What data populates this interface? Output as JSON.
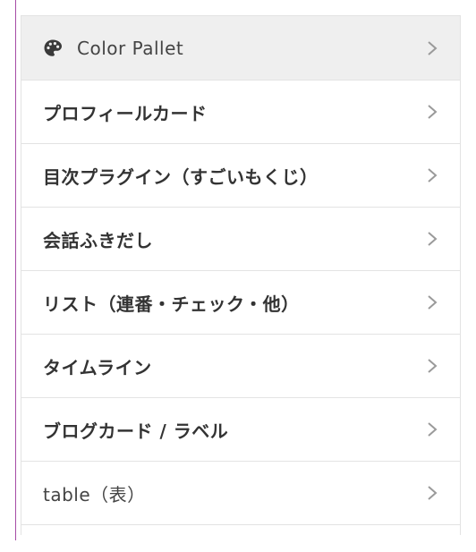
{
  "menu": {
    "items": [
      {
        "label": "Color Pallet",
        "icon": "palette-icon",
        "active": true
      },
      {
        "label": "プロフィールカード"
      },
      {
        "label": "目次プラグイン（すごいもくじ）"
      },
      {
        "label": "会話ふきだし"
      },
      {
        "label": "リスト（連番・チェック・他）"
      },
      {
        "label": "タイムライン"
      },
      {
        "label": "ブログカード / ラベル"
      },
      {
        "label": "table（表）"
      }
    ],
    "chevron_icon": "chevron-right-icon"
  },
  "colors": {
    "active_background": "#efefef",
    "border": "#e3e3e3",
    "text": "#333333",
    "chevron": "#9a9a9a",
    "left_rule": "#a64ca6"
  }
}
